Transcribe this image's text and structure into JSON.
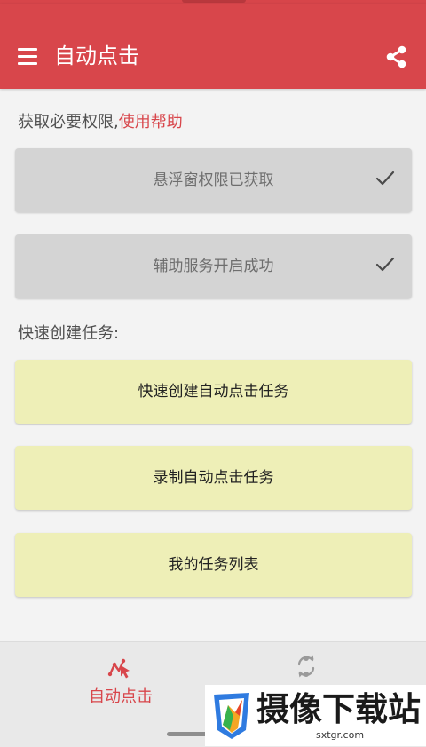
{
  "app_bar": {
    "title": "自动点击",
    "background": "#d8464b",
    "menu_icon": "menu-icon",
    "share_icon": "share-icon"
  },
  "permissions": {
    "label": "获取必要权限,",
    "help_link": "使用帮助",
    "items": [
      {
        "label": "悬浮窗权限已获取",
        "icon": "check-icon",
        "granted": true
      },
      {
        "label": "辅助服务开启成功",
        "icon": "check-icon",
        "granted": true
      }
    ]
  },
  "quick_create": {
    "label": "快速创建任务:",
    "actions": [
      {
        "label": "快速创建自动点击任务"
      },
      {
        "label": "录制自动点击任务"
      },
      {
        "label": "我的任务列表"
      }
    ]
  },
  "bottom_nav": {
    "tabs": [
      {
        "label": "自动点击",
        "icon": "auto-click-icon",
        "active": true
      },
      {
        "label": "",
        "icon": "sync-icon",
        "active": false
      }
    ],
    "active_color": "#d8464b"
  },
  "watermark": {
    "text": "摄像下载站",
    "url": "sxtgr.com"
  }
}
